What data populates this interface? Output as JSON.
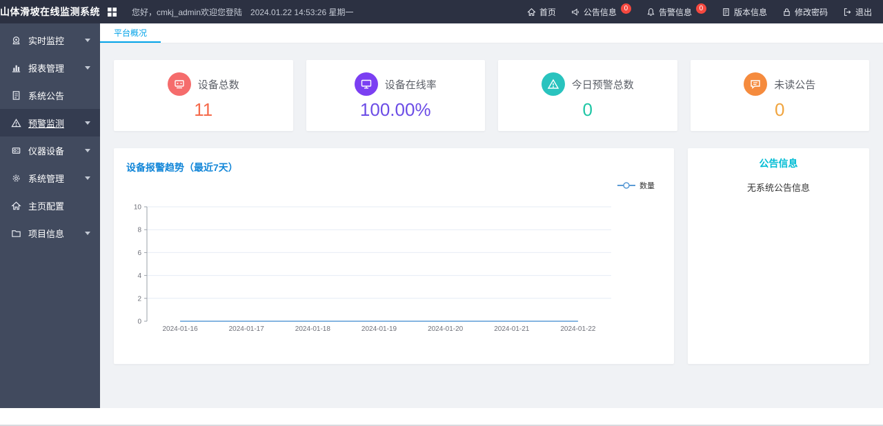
{
  "app": {
    "title": "山体滑坡在线监测系统"
  },
  "colors": {
    "header_bg": "#2c3142",
    "sidebar_bg": "#414a5e",
    "sidebar_active_bg": "#343c50",
    "tab_accent": "#00a2e8",
    "chart_title": "#1286d8",
    "notice_title": "#00bcd4",
    "badge": "#f5483f",
    "stat_red": "#f5694a",
    "stat_purple": "#6b4ce6",
    "stat_teal": "#1fc6a5",
    "stat_orange": "#f0a43e"
  },
  "header": {
    "greeting": "您好，cmkj_admin欢迎您登陆",
    "datetime": "2024.01.22 14:53:26 星期一",
    "nav": [
      {
        "label": "首页",
        "icon": "home-icon"
      },
      {
        "label": "公告信息",
        "icon": "announcement-icon",
        "badge": "0"
      },
      {
        "label": "告警信息",
        "icon": "alarm-icon",
        "badge": "0"
      },
      {
        "label": "版本信息",
        "icon": "version-icon"
      },
      {
        "label": "修改密码",
        "icon": "password-icon"
      },
      {
        "label": "退出",
        "icon": "logout-icon"
      }
    ]
  },
  "sidebar": {
    "items": [
      {
        "label": "实时监控",
        "icon": "monitor-icon",
        "expandable": true,
        "active": false
      },
      {
        "label": "报表管理",
        "icon": "report-icon",
        "expandable": true,
        "active": false
      },
      {
        "label": "系统公告",
        "icon": "notice-icon",
        "expandable": false,
        "active": false
      },
      {
        "label": "预警监测",
        "icon": "warning-icon",
        "expandable": true,
        "active": true
      },
      {
        "label": "仪器设备",
        "icon": "device-icon",
        "expandable": true,
        "active": false
      },
      {
        "label": "系统管理",
        "icon": "settings-icon",
        "expandable": true,
        "active": false
      },
      {
        "label": "主页配置",
        "icon": "homepage-icon",
        "expandable": false,
        "active": false
      },
      {
        "label": "项目信息",
        "icon": "project-icon",
        "expandable": true,
        "active": false
      }
    ]
  },
  "tabs": [
    {
      "label": "平台概况",
      "active": true
    }
  ],
  "stats": [
    {
      "label": "设备总数",
      "value": "11",
      "color": "#f5694a",
      "icon": "device-count-icon"
    },
    {
      "label": "设备在线率",
      "value": "100.00%",
      "color": "#6b4ce6",
      "icon": "online-rate-icon"
    },
    {
      "label": "今日预警总数",
      "value": "0",
      "color": "#1fc6a5",
      "icon": "today-warning-icon"
    },
    {
      "label": "未读公告",
      "value": "0",
      "color": "#f0a43e",
      "icon": "unread-notice-icon"
    }
  ],
  "chart_data": {
    "type": "line",
    "title": "设备报警趋势（最近7天）",
    "x": [
      "2024-01-16",
      "2024-01-17",
      "2024-01-18",
      "2024-01-19",
      "2024-01-20",
      "2024-01-21",
      "2024-01-22"
    ],
    "series": [
      {
        "name": "数量",
        "values": [
          0,
          0,
          0,
          0,
          0,
          0,
          0
        ],
        "color": "#5b9bd5"
      }
    ],
    "ylim": [
      0,
      10
    ],
    "yticks": [
      0,
      2,
      4,
      6,
      8,
      10
    ],
    "grid": true,
    "legend_position": "top-right"
  },
  "notice_card": {
    "title": "公告信息",
    "empty_text": "无系统公告信息"
  }
}
